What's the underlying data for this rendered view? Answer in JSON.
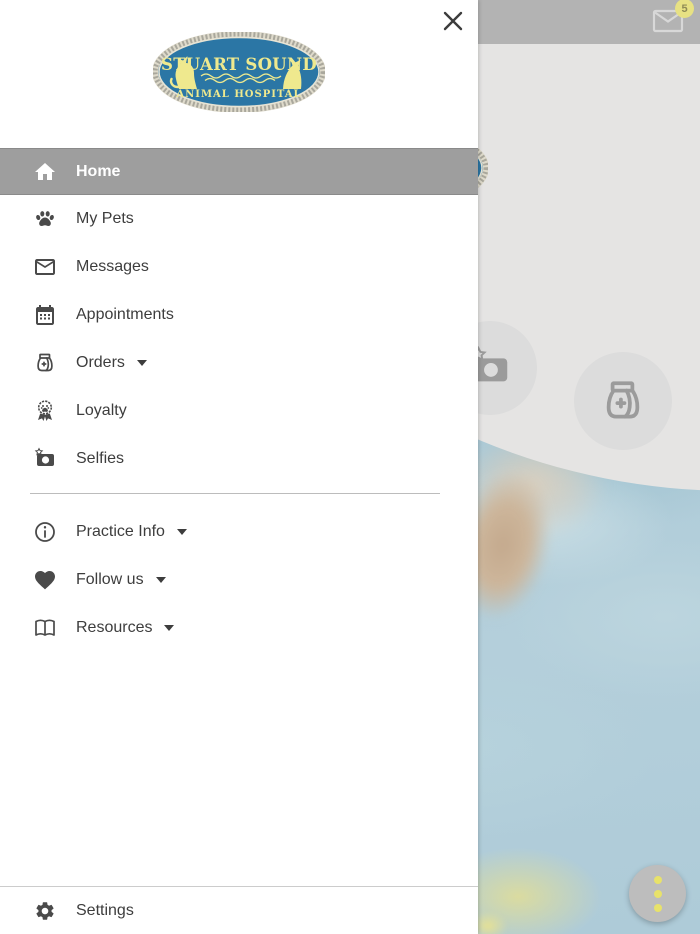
{
  "logo": {
    "line1": "STUART SOUND",
    "line2": "ANIMAL HOSPITAL"
  },
  "header": {
    "badge_count": "5"
  },
  "drawer": {
    "menu": [
      {
        "label": "Home",
        "icon": "home-icon",
        "selected": true,
        "dropdown": false
      },
      {
        "label": "My Pets",
        "icon": "paw-icon",
        "selected": false,
        "dropdown": false
      },
      {
        "label": "Messages",
        "icon": "envelope-icon",
        "selected": false,
        "dropdown": false
      },
      {
        "label": "Appointments",
        "icon": "calendar-icon",
        "selected": false,
        "dropdown": false
      },
      {
        "label": "Orders",
        "icon": "food-bag-icon",
        "selected": false,
        "dropdown": true
      },
      {
        "label": "Loyalty",
        "icon": "award-icon",
        "selected": false,
        "dropdown": false
      },
      {
        "label": "Selfies",
        "icon": "camera-star-icon",
        "selected": false,
        "dropdown": false
      }
    ],
    "secondary": [
      {
        "label": "Practice Info",
        "icon": "info-icon",
        "dropdown": true
      },
      {
        "label": "Follow us",
        "icon": "heart-icon",
        "dropdown": true
      },
      {
        "label": "Resources",
        "icon": "book-icon",
        "dropdown": true
      }
    ],
    "settings_label": "Settings"
  },
  "colors": {
    "logo_blue": "#2b76a5",
    "logo_yellow": "#efe98e",
    "selected_row_gray": "#9e9e9e",
    "header_gray": "#b3b3b3",
    "accent_yellow": "#e8e26a",
    "badge_yellow": "#e7e183",
    "panel_gray": "#e5e4e3"
  }
}
